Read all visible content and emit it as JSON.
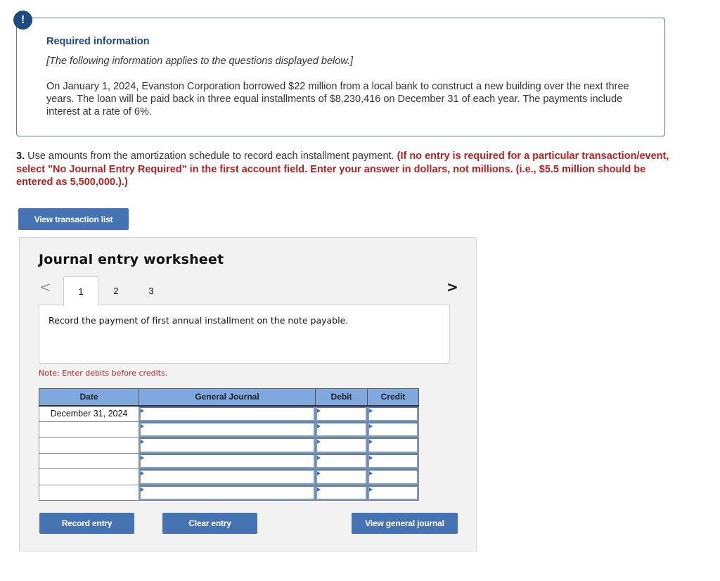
{
  "info": {
    "badge_icon": "exclamation-icon",
    "badge_glyph": "!",
    "title": "Required information",
    "subtitle": "[The following information applies to the questions displayed below.]",
    "body": "On January 1, 2024, Evanston Corporation borrowed $22 million from a local bank to construct a new building over the next three years. The loan will be paid back in three equal installments of $8,230,416 on December 31 of each year. The payments include interest at a rate of 6%."
  },
  "question": {
    "number": "3.",
    "text": " Use amounts from the amortization schedule to record each installment payment. ",
    "warning": "(If no entry is required for a particular transaction/event, select \"No Journal Entry Required\" in the first account field. Enter your answer in dollars, not millions. (i.e., $5.5 million should be entered as 5,500,000.).)"
  },
  "buttons": {
    "view_transaction_list": "View transaction list",
    "record_entry": "Record entry",
    "clear_entry": "Clear entry",
    "view_general_journal": "View general journal"
  },
  "worksheet": {
    "title": "Journal entry worksheet",
    "prev_glyph": "<",
    "next_glyph": ">",
    "tabs": [
      {
        "label": "1",
        "active": true
      },
      {
        "label": "2",
        "active": false
      },
      {
        "label": "3",
        "active": false
      }
    ],
    "description": "Record the payment of first annual installment on the note payable.",
    "note": "Note: Enter debits before credits."
  },
  "journal": {
    "headers": [
      "Date",
      "General Journal",
      "Debit",
      "Credit"
    ],
    "rows": [
      {
        "date": "December 31, 2024",
        "account": "",
        "debit": "",
        "credit": ""
      },
      {
        "date": "",
        "account": "",
        "debit": "",
        "credit": ""
      },
      {
        "date": "",
        "account": "",
        "debit": "",
        "credit": ""
      },
      {
        "date": "",
        "account": "",
        "debit": "",
        "credit": ""
      },
      {
        "date": "",
        "account": "",
        "debit": "",
        "credit": ""
      },
      {
        "date": "",
        "account": "",
        "debit": "",
        "credit": ""
      }
    ]
  },
  "colors": {
    "brand_blue": "#4573b3",
    "header_blue": "#7ea8de",
    "warning_red": "#b22222",
    "info_navy": "#1f4a7e"
  }
}
